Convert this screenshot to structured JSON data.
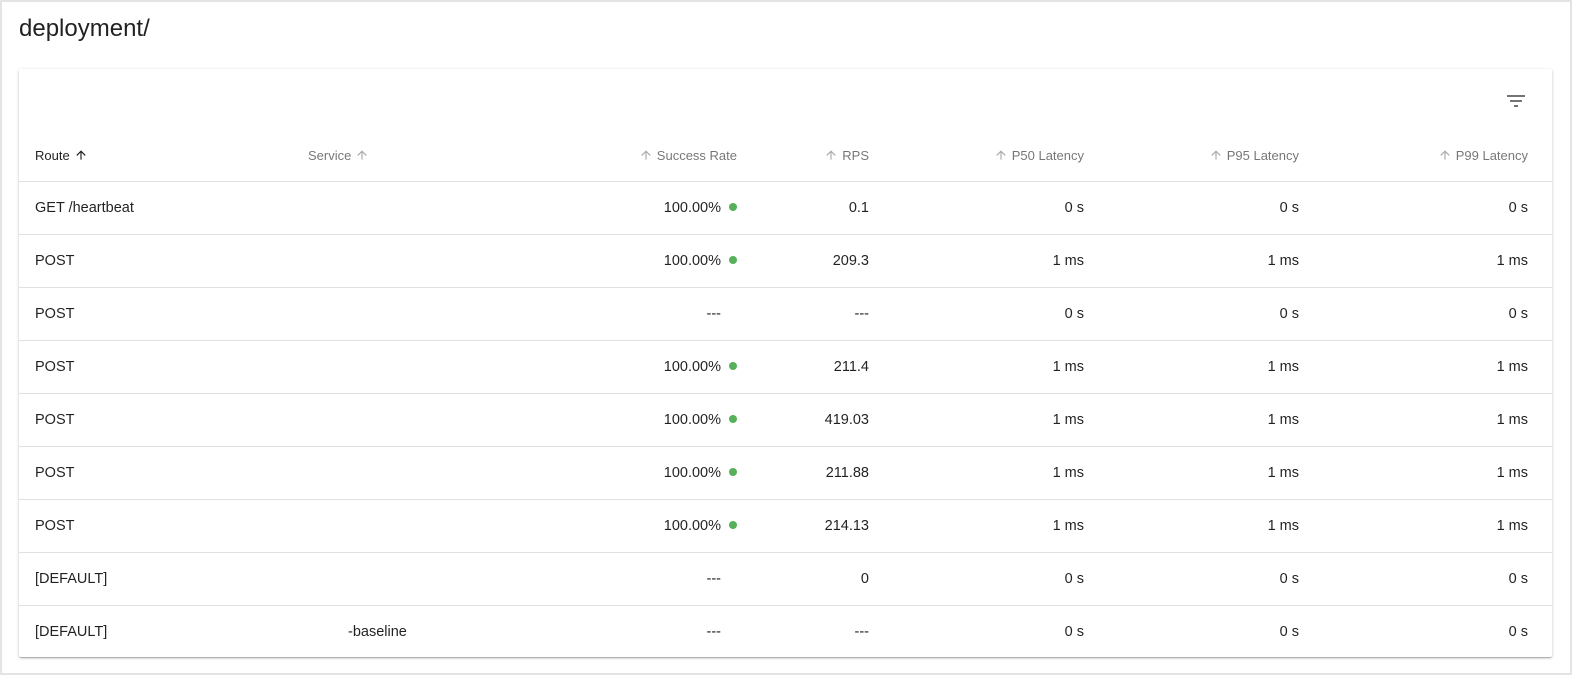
{
  "page": {
    "title": "deployment/"
  },
  "colors": {
    "success_dot": "#57b05a",
    "divider": "#e0e0e0"
  },
  "toolbar": {
    "filter_icon": "filter-list-icon"
  },
  "table": {
    "headers": {
      "route": "Route",
      "service": "Service",
      "success_rate": "Success Rate",
      "rps": "RPS",
      "p50": "P50 Latency",
      "p95": "P95 Latency",
      "p99": "P99 Latency"
    },
    "rows": [
      {
        "route": "GET /heartbeat",
        "service": "",
        "success_rate": "100.00%",
        "healthy": true,
        "rps": "0.1",
        "p50": "0 s",
        "p95": "0 s",
        "p99": "0 s"
      },
      {
        "route": "POST",
        "service": "",
        "success_rate": "100.00%",
        "healthy": true,
        "rps": "209.3",
        "p50": "1 ms",
        "p95": "1 ms",
        "p99": "1 ms"
      },
      {
        "route": "POST",
        "service": "",
        "success_rate": "---",
        "healthy": false,
        "rps": "---",
        "p50": "0 s",
        "p95": "0 s",
        "p99": "0 s"
      },
      {
        "route": "POST",
        "service": "",
        "success_rate": "100.00%",
        "healthy": true,
        "rps": "211.4",
        "p50": "1 ms",
        "p95": "1 ms",
        "p99": "1 ms"
      },
      {
        "route": "POST",
        "service": "",
        "success_rate": "100.00%",
        "healthy": true,
        "rps": "419.03",
        "p50": "1 ms",
        "p95": "1 ms",
        "p99": "1 ms"
      },
      {
        "route": "POST",
        "service": "",
        "success_rate": "100.00%",
        "healthy": true,
        "rps": "211.88",
        "p50": "1 ms",
        "p95": "1 ms",
        "p99": "1 ms"
      },
      {
        "route": "POST",
        "service": "",
        "success_rate": "100.00%",
        "healthy": true,
        "rps": "214.13",
        "p50": "1 ms",
        "p95": "1 ms",
        "p99": "1 ms"
      },
      {
        "route": "[DEFAULT]",
        "service": "",
        "success_rate": "---",
        "healthy": false,
        "rps": "0",
        "p50": "0 s",
        "p95": "0 s",
        "p99": "0 s"
      },
      {
        "route": "[DEFAULT]",
        "service": "-baseline",
        "success_rate": "---",
        "healthy": false,
        "rps": "---",
        "p50": "0 s",
        "p95": "0 s",
        "p99": "0 s"
      }
    ]
  }
}
